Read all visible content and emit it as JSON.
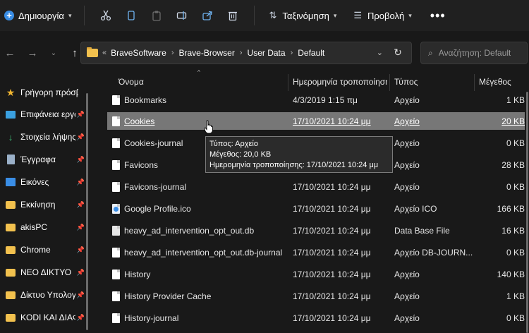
{
  "toolbar": {
    "new_label": "Δημιουργία",
    "sort_label": "Ταξινόμηση",
    "view_label": "Προβολή",
    "more_label": "•••"
  },
  "address": {
    "overflow": "«",
    "crumbs": [
      "BraveSoftware",
      "Brave-Browser",
      "User Data",
      "Default"
    ]
  },
  "search": {
    "placeholder": "Αναζήτηση: Default"
  },
  "sidebar": {
    "items": [
      {
        "label": "Γρήγορη πρόσβαση",
        "icon": "star-icon",
        "pinned": false
      },
      {
        "label": "Επιφάνεια εργασίας",
        "icon": "desktop-icon",
        "pinned": true
      },
      {
        "label": "Στοιχεία λήψης",
        "icon": "download-icon",
        "pinned": true
      },
      {
        "label": "Έγγραφα",
        "icon": "document-icon",
        "pinned": true
      },
      {
        "label": "Εικόνες",
        "icon": "pictures-icon",
        "pinned": true
      },
      {
        "label": "Εκκίνηση",
        "icon": "folder-icon",
        "pinned": true
      },
      {
        "label": "akisPC",
        "icon": "folder-icon",
        "pinned": true
      },
      {
        "label": "Chrome",
        "icon": "folder-icon",
        "pinned": true
      },
      {
        "label": "ΝΕΟ ΔΙΚΤΥΟ",
        "icon": "folder-icon",
        "pinned": true
      },
      {
        "label": "Δίκτυο Υπολογιστών",
        "icon": "folder-icon",
        "pinned": true
      },
      {
        "label": "KODI ΚΑΙ ΔΙΑΦΟΡΑ",
        "icon": "folder-icon",
        "pinned": true
      }
    ]
  },
  "columns": {
    "name": "Όνομα",
    "date": "Ημερομηνία τροποποίησης",
    "type": "Τύπος",
    "size": "Μέγεθος"
  },
  "files": [
    {
      "name": "Bookmarks",
      "date": "4/3/2019 1:15 πμ",
      "type": "Αρχείο",
      "size": "1 KB",
      "icon": "file-icon"
    },
    {
      "name": "Cookies",
      "date": "17/10/2021 10:24 μμ",
      "type": "Αρχείο",
      "size": "20 KB",
      "icon": "file-icon",
      "selected": true
    },
    {
      "name": "Cookies-journal",
      "date": "",
      "type": "Αρχείο",
      "size": "0 KB",
      "icon": "file-icon"
    },
    {
      "name": "Favicons",
      "date": "",
      "type": "Αρχείο",
      "size": "28 KB",
      "icon": "file-icon"
    },
    {
      "name": "Favicons-journal",
      "date": "17/10/2021 10:24 μμ",
      "type": "Αρχείο",
      "size": "0 KB",
      "icon": "file-icon"
    },
    {
      "name": "Google Profile.ico",
      "date": "17/10/2021 10:24 μμ",
      "type": "Αρχείο ICO",
      "size": "166 KB",
      "icon": "ico-file-icon"
    },
    {
      "name": "heavy_ad_intervention_opt_out.db",
      "date": "17/10/2021 10:24 μμ",
      "type": "Data Base File",
      "size": "16 KB",
      "icon": "db-file-icon"
    },
    {
      "name": "heavy_ad_intervention_opt_out.db-journal",
      "date": "17/10/2021 10:24 μμ",
      "type": "Αρχείο DB-JOURN...",
      "size": "0 KB",
      "icon": "file-icon"
    },
    {
      "name": "History",
      "date": "17/10/2021 10:24 μμ",
      "type": "Αρχείο",
      "size": "140 KB",
      "icon": "file-icon"
    },
    {
      "name": "History Provider Cache",
      "date": "17/10/2021 10:24 μμ",
      "type": "Αρχείο",
      "size": "1 KB",
      "icon": "file-icon"
    },
    {
      "name": "History-journal",
      "date": "17/10/2021 10:24 μμ",
      "type": "Αρχείο",
      "size": "0 KB",
      "icon": "file-icon"
    }
  ],
  "tooltip": {
    "type_line": "Τύπος: Αρχείο",
    "size_line": "Μέγεθος: 20,0 KB",
    "date_line": "Ημερομηνία τροποποίησης: 17/10/2021 10:24 μμ"
  },
  "colors": {
    "accent": "#3a8ee6",
    "folder": "#f2c14e",
    "selection": "#777777"
  }
}
